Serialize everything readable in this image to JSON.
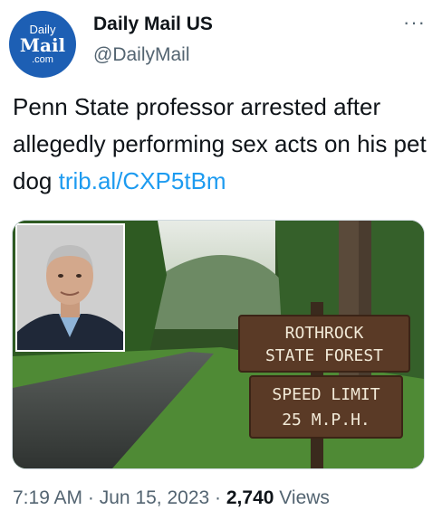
{
  "account": {
    "avatar_line1": "Daily",
    "avatar_line2": "Mail",
    "avatar_line3": ".com",
    "display_name": "Daily Mail US",
    "handle": "@DailyMail",
    "more_label": "···"
  },
  "tweet": {
    "text": "Penn State professor arrested after allegedly performing sex acts on his pet dog",
    "link": "trib.al/CXP5tBm"
  },
  "media": {
    "sign_line1": "ROTHROCK",
    "sign_line2": "STATE FOREST",
    "sign_line3": "SPEED LIMIT",
    "sign_line4": "25 M.P.H."
  },
  "meta": {
    "time": "7:19 AM",
    "separator": "·",
    "date": "Jun 15, 2023",
    "views_count": "2,740",
    "views_label": "Views"
  },
  "colors": {
    "brand_blue": "#1d5fb4",
    "link": "#1d9bf0",
    "secondary_text": "#536471"
  }
}
